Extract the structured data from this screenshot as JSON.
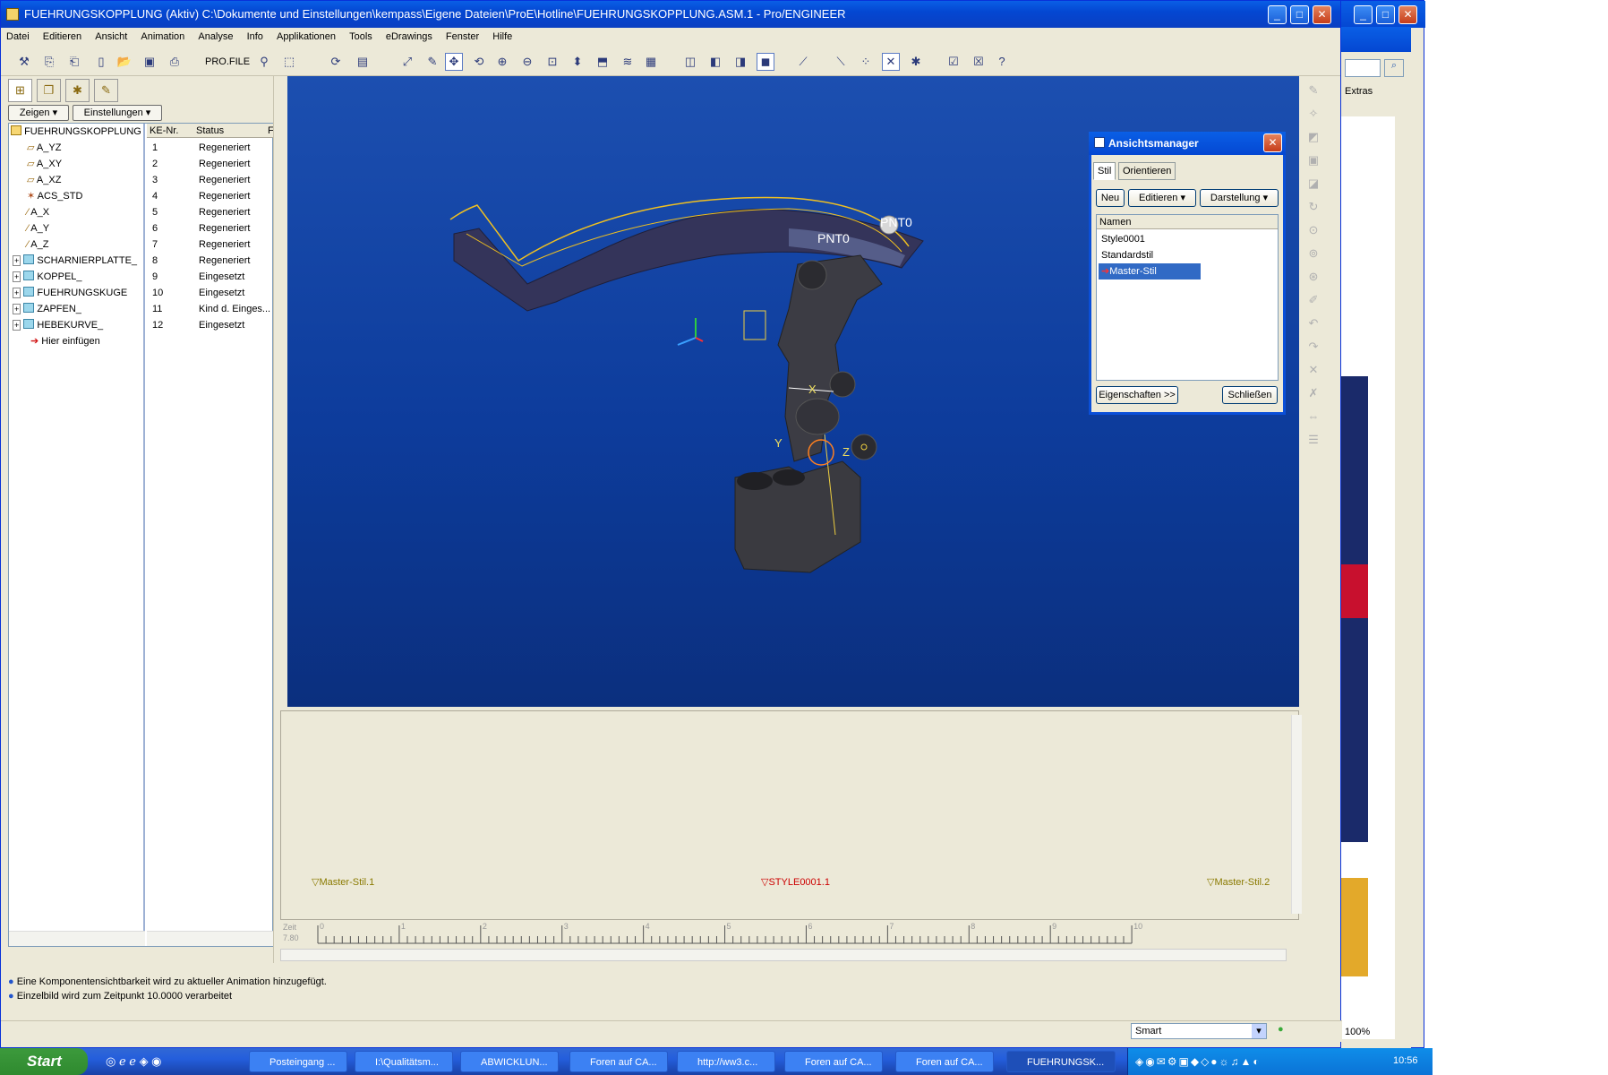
{
  "window": {
    "title": "FUEHRUNGSKOPPLUNG (Aktiv) C:\\Dokumente und Einstellungen\\kempass\\Eigene Dateien\\ProE\\Hotline\\FUEHRUNGSKOPPLUNG.ASM.1 - Pro/ENGINEER"
  },
  "menu": [
    "Datei",
    "Editieren",
    "Ansicht",
    "Animation",
    "Analyse",
    "Info",
    "Applikationen",
    "Tools",
    "eDrawings",
    "Fenster",
    "Hilfe"
  ],
  "toolbar": {
    "profile_label": "PRO.FILE"
  },
  "tree": {
    "show_label": "Zeigen",
    "settings_label": "Einstellungen",
    "root": "FUEHRUNGSKOPPLUNG",
    "col_ke": "KE-Nr.",
    "col_status": "Status",
    "col_f": "F",
    "rows": [
      {
        "name": "A_YZ",
        "ke": "1",
        "status": "Regeneriert"
      },
      {
        "name": "A_XY",
        "ke": "2",
        "status": "Regeneriert"
      },
      {
        "name": "A_XZ",
        "ke": "3",
        "status": "Regeneriert"
      },
      {
        "name": "ACS_STD",
        "ke": "4",
        "status": "Regeneriert"
      },
      {
        "name": "A_X",
        "ke": "5",
        "status": "Regeneriert"
      },
      {
        "name": "A_Y",
        "ke": "6",
        "status": "Regeneriert"
      },
      {
        "name": "A_Z",
        "ke": "7",
        "status": "Regeneriert"
      },
      {
        "name": "SCHARNIERPLATTE_",
        "ke": "8",
        "status": "Regeneriert"
      },
      {
        "name": "KOPPEL_",
        "ke": "9",
        "status": "Eingesetzt"
      },
      {
        "name": "FUEHRUNGSKUGE",
        "ke": "10",
        "status": "Eingesetzt"
      },
      {
        "name": "ZAPFEN_",
        "ke": "11",
        "status": "Kind d. Einges..."
      },
      {
        "name": "HEBEKURVE_",
        "ke": "12",
        "status": "Eingesetzt"
      }
    ],
    "insert_here": "Hier einfügen"
  },
  "graphics": {
    "labels": [
      "PNT0",
      "PNT0",
      "X",
      "Y",
      "Z"
    ]
  },
  "view_manager": {
    "title": "Ansichtsmanager",
    "tabs": [
      "Stil",
      "Orientieren"
    ],
    "new_label": "Neu",
    "edit_label": "Editieren",
    "display_label": "Darstellung",
    "col_names": "Namen",
    "styles": [
      "Style0001",
      "Standardstil",
      "Master-Stil"
    ],
    "selected_style": "Master-Stil",
    "properties_label": "Eigenschaften >>",
    "close_label": "Schließen"
  },
  "timeline": {
    "markers": [
      "Master-Stil.1",
      "STYLE0001.1",
      "Master-Stil.2"
    ],
    "time_label": "Zeit",
    "time_value": "7.80",
    "ticks": [
      "0",
      "1",
      "2",
      "3",
      "4",
      "5",
      "6",
      "7",
      "8",
      "9",
      "10"
    ]
  },
  "messages": [
    "Eine Komponentensichtbarkeit wird zu aktueller Animation hinzugefügt.",
    "Einzelbild wird zum Zeitpunkt 10.0000 verarbeitet"
  ],
  "status": {
    "filter_value": "Smart"
  },
  "browser": {
    "extras_label": "Extras",
    "zoom": "100%"
  },
  "taskbar": {
    "start_label": "Start",
    "tasks": [
      "Posteingang ...",
      "I:\\Qualitätsm...",
      "ABWICKLUN...",
      "Foren auf CA...",
      "http://ww3.c...",
      "Foren auf CA...",
      "Foren auf CA...",
      "FUEHRUNGSK..."
    ],
    "clock": "10:56"
  },
  "colors": {
    "viewport_top": "#1c4fb0",
    "viewport_bottom": "#0b2f7e",
    "xp_blue": "#0a5fe6",
    "selection": "#316ac5",
    "marker_red": "#cc0000",
    "marker_olive": "#8a7a00"
  }
}
